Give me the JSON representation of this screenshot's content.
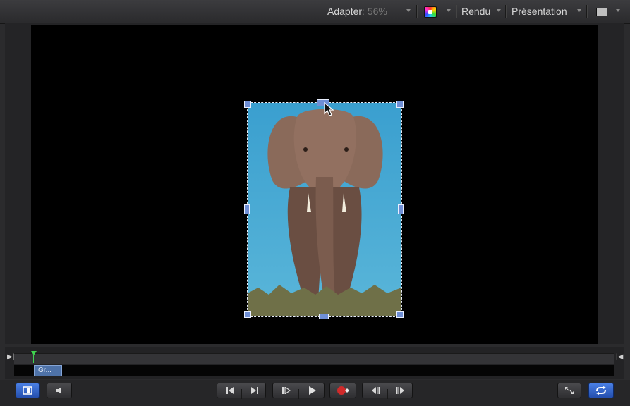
{
  "toolbar": {
    "fit_label": "Adapter",
    "fit_value": ": 56%",
    "render_label": "Rendu",
    "presentation_label": "Présentation"
  },
  "timeline": {
    "clip_label": "Gr..."
  },
  "colors": {
    "accent_blue": "#2f63d0",
    "playhead_green": "#3fd34f",
    "clip_blue": "#4e72a8",
    "canvas_bg": "#000000"
  },
  "icons": {
    "color_channels": "color-wheel-icon",
    "view_layout": "view-layout-icon",
    "show_inspector": "inspector-icon",
    "audio": "speaker-icon",
    "go_to_start": "go-to-start-icon",
    "go_to_end": "go-to-end-icon",
    "play_from_start": "play-from-start-icon",
    "play": "play-icon",
    "record": "record-icon",
    "prev_frame": "previous-frame-icon",
    "next_frame": "next-frame-icon",
    "fullscreen": "fullscreen-icon",
    "loop": "loop-icon"
  }
}
